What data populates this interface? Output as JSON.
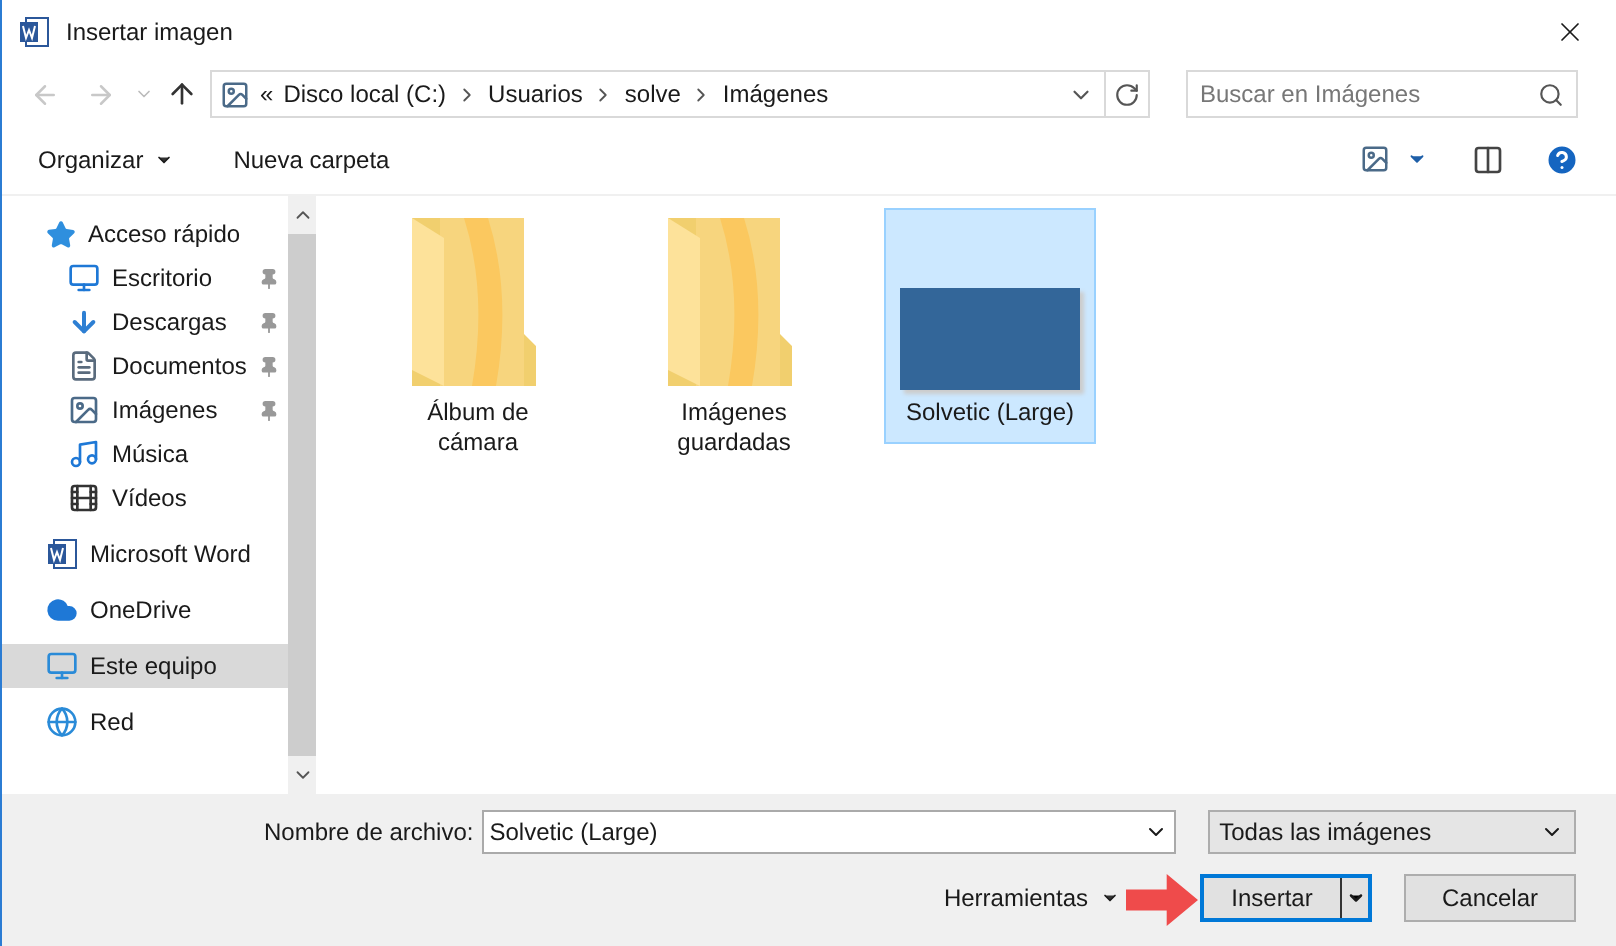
{
  "window": {
    "title": "Insertar imagen"
  },
  "nav": {
    "back_disabled": true,
    "forward_disabled": true,
    "overflow": "«",
    "breadcrumb": [
      "Disco local (C:)",
      "Usuarios",
      "solve",
      "Imágenes"
    ],
    "search": {
      "placeholder": "Buscar en Imágenes"
    }
  },
  "toolbar": {
    "organize": "Organizar",
    "new_folder": "Nueva carpeta"
  },
  "sidebar": {
    "items": [
      {
        "label": "Acceso rápido",
        "kind": "star",
        "selected": false,
        "children": [
          {
            "label": "Escritorio",
            "kind": "desktop",
            "pinned": true,
            "selected": false
          },
          {
            "label": "Descargas",
            "kind": "download",
            "pinned": true,
            "selected": false
          },
          {
            "label": "Documentos",
            "kind": "document",
            "pinned": true,
            "selected": false
          },
          {
            "label": "Imágenes",
            "kind": "image",
            "pinned": true,
            "selected": false
          },
          {
            "label": "Música",
            "kind": "music",
            "pinned": false,
            "selected": false
          },
          {
            "label": "Vídeos",
            "kind": "video",
            "pinned": false,
            "selected": false
          }
        ]
      },
      {
        "label": "Microsoft Word",
        "kind": "word",
        "selected": false
      },
      {
        "label": "OneDrive",
        "kind": "cloud",
        "selected": false
      },
      {
        "label": "Este equipo",
        "kind": "computer",
        "selected": true
      },
      {
        "label": "Red",
        "kind": "network",
        "selected": false
      }
    ]
  },
  "files": [
    {
      "name": "Álbum de cámara",
      "kind": "folder",
      "selected": false
    },
    {
      "name": "Imágenes guardadas",
      "kind": "folder",
      "selected": false
    },
    {
      "name": "Solvetic (Large)",
      "kind": "image",
      "selected": true
    }
  ],
  "footer": {
    "filename_label": "Nombre de archivo:",
    "filename_value": "Solvetic (Large)",
    "filter": "Todas las imágenes",
    "tools": "Herramientas",
    "insert": "Insertar",
    "cancel": "Cancelar"
  }
}
